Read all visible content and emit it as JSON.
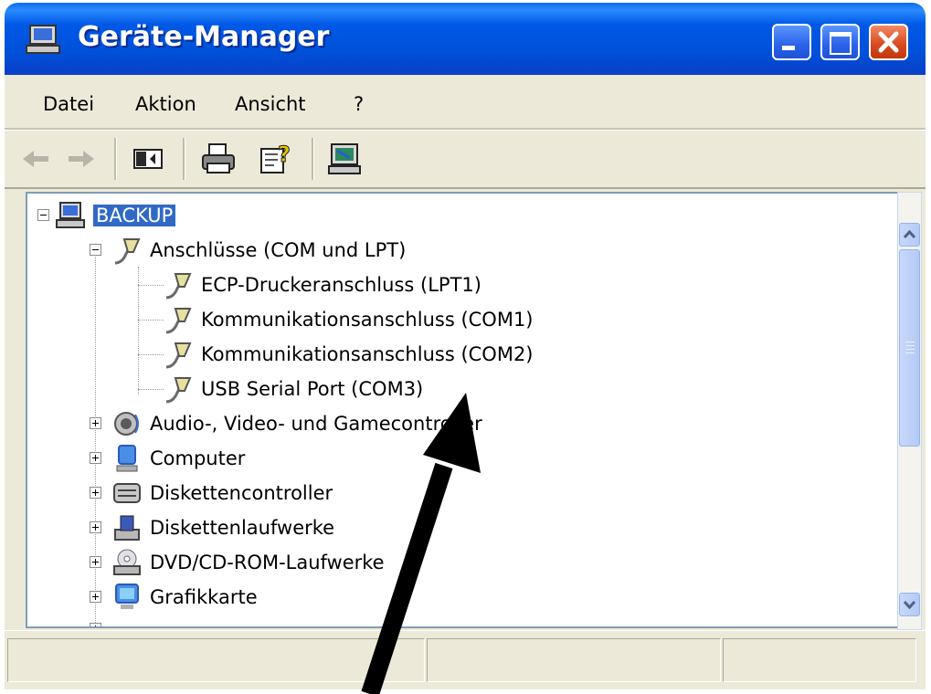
{
  "window": {
    "title": "Geräte-Manager"
  },
  "menu": {
    "datei": "Datei",
    "aktion": "Aktion",
    "ansicht": "Ansicht",
    "help": "?"
  },
  "toolbar": {
    "buttons": [
      "back-arrow-icon",
      "forward-arrow-icon",
      "show-hide-console-tree-icon",
      "print-icon",
      "properties-help-icon",
      "update-hardware-icon"
    ]
  },
  "tree": {
    "root": "BACKUP",
    "items": [
      "Anschlüsse (COM und LPT)",
      "ECP-Druckeranschluss (LPT1)",
      "Kommunikationsanschluss (COM1)",
      "Kommunikationsanschluss (COM2)",
      "USB Serial Port (COM3)",
      "Audio-, Video- und Gamecontroller",
      "Computer",
      "Diskettencontroller",
      "Diskettenlaufwerke",
      "DVD/CD-ROM-Laufwerke",
      "Grafikkarte"
    ]
  },
  "colors": {
    "titlebar": "#0050d8",
    "selection": "#316ac5",
    "annotation_arrow": "#000000"
  }
}
